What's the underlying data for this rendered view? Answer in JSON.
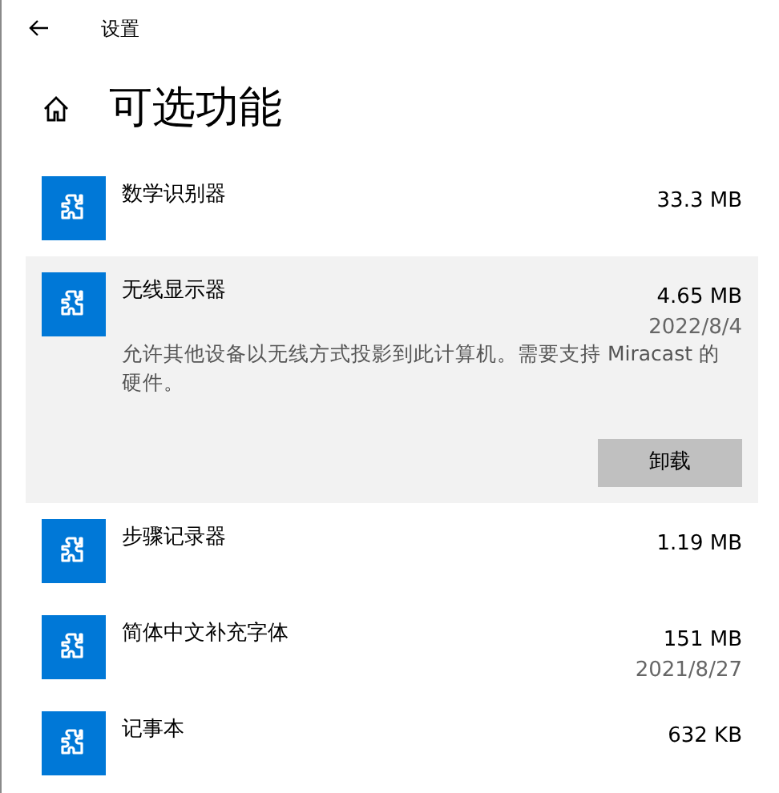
{
  "window": {
    "title": "设置"
  },
  "page": {
    "title": "可选功能"
  },
  "features": [
    {
      "name": "数学识别器",
      "size": "33.3 MB",
      "selected": false
    },
    {
      "name": "无线显示器",
      "size": "4.65 MB",
      "date": "2022/8/4",
      "description": "允许其他设备以无线方式投影到此计算机。需要支持 Miracast 的硬件。",
      "button": "卸载",
      "selected": true
    },
    {
      "name": "步骤记录器",
      "size": "1.19 MB",
      "selected": false
    },
    {
      "name": "简体中文补充字体",
      "size": "151 MB",
      "date": "2021/8/27",
      "selected": false
    },
    {
      "name": "记事本",
      "size": "632 KB",
      "selected": false
    }
  ]
}
